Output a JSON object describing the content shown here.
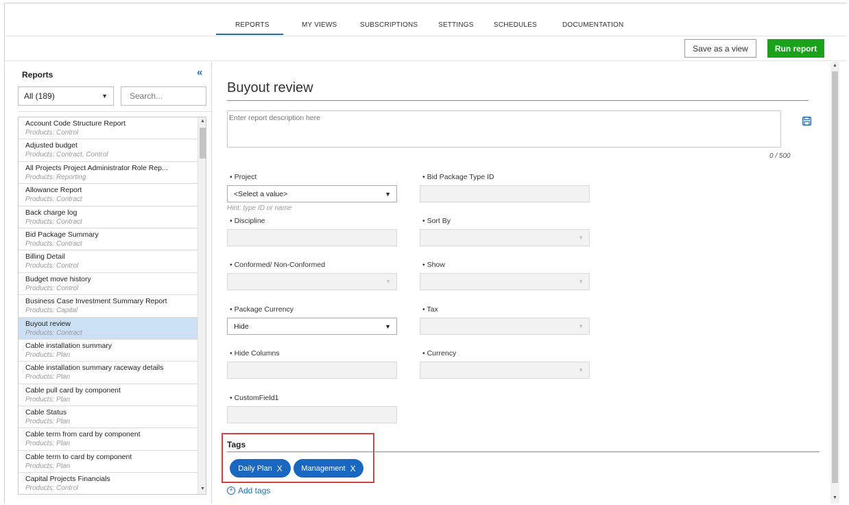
{
  "nav": {
    "tabs": [
      {
        "label": "REPORTS"
      },
      {
        "label": "MY VIEWS"
      },
      {
        "label": "SUBSCRIPTIONS"
      },
      {
        "label": "SETTINGS"
      },
      {
        "label": "SCHEDULES"
      },
      {
        "label": "DOCUMENTATION"
      }
    ],
    "active_tab": "REPORTS"
  },
  "toolbar": {
    "save_view_label": "Save as a view",
    "run_report_label": "Run report"
  },
  "sidebar": {
    "title": "Reports",
    "collapse_icon": "double-chevron-left-icon",
    "filter_value": "All (189)",
    "search_placeholder": "Search...",
    "items": [
      {
        "name": "Account Code Structure Report",
        "products": "Products: Control"
      },
      {
        "name": "Adjusted budget",
        "products": "Products: Contract, Control"
      },
      {
        "name": "All Projects Project Administrator Role Rep...",
        "products": "Products: Reporting"
      },
      {
        "name": "Allowance Report",
        "products": "Products: Contract"
      },
      {
        "name": "Back charge log",
        "products": "Products: Contract"
      },
      {
        "name": "Bid Package Summary",
        "products": "Products: Contract"
      },
      {
        "name": "Billing Detail",
        "products": "Products: Control"
      },
      {
        "name": "Budget move history",
        "products": "Products: Control"
      },
      {
        "name": "Business Case Investment Summary Report",
        "products": "Products: Capital"
      },
      {
        "name": "Buyout review",
        "products": "Products: Contract"
      },
      {
        "name": "Cable installation summary",
        "products": "Products: Plan"
      },
      {
        "name": "Cable installation summary raceway details",
        "products": "Products: Plan"
      },
      {
        "name": "Cable pull card by component",
        "products": "Products: Plan"
      },
      {
        "name": "Cable Status",
        "products": "Products: Plan"
      },
      {
        "name": "Cable term from card by component",
        "products": "Products: Plan"
      },
      {
        "name": "Cable term to card by component",
        "products": "Products: Plan"
      },
      {
        "name": "Capital Projects Financials",
        "products": "Products: Control"
      }
    ],
    "selected_item": "Buyout review"
  },
  "main": {
    "title": "Buyout review",
    "description_placeholder": "Enter report description here",
    "description_counter": "0 / 500",
    "save_icon": "floppy-disk-icon",
    "fields": {
      "project": {
        "label": "• Project",
        "value": "<Select a value>",
        "hint": "Hint: type ID or name"
      },
      "bid_package_type_id": {
        "label": "• Bid Package Type ID",
        "value": ""
      },
      "discipline": {
        "label": "• Discipline",
        "value": ""
      },
      "sort_by": {
        "label": "• Sort By",
        "value": ""
      },
      "conformed": {
        "label": "• Conformed/ Non-Conformed",
        "value": ""
      },
      "show": {
        "label": "• Show",
        "value": ""
      },
      "package_currency": {
        "label": "• Package Currency",
        "value": "Hide"
      },
      "tax": {
        "label": "• Tax",
        "value": ""
      },
      "hide_columns": {
        "label": "• Hide Columns",
        "value": ""
      },
      "currency": {
        "label": "• Currency",
        "value": ""
      },
      "custom_field1": {
        "label": "• CustomField1",
        "value": ""
      }
    },
    "tags": {
      "title": "Tags",
      "items": [
        {
          "label": "Daily Plan",
          "remove": "X"
        },
        {
          "label": "Management",
          "remove": "X"
        }
      ],
      "add_label": "Add tags"
    }
  },
  "colors": {
    "accent_blue": "#1f6fb2",
    "run_green": "#1aa31a",
    "tag_blue": "#1967c0",
    "selected_row": "#cce0f5",
    "highlight_red": "#d43f3f"
  }
}
